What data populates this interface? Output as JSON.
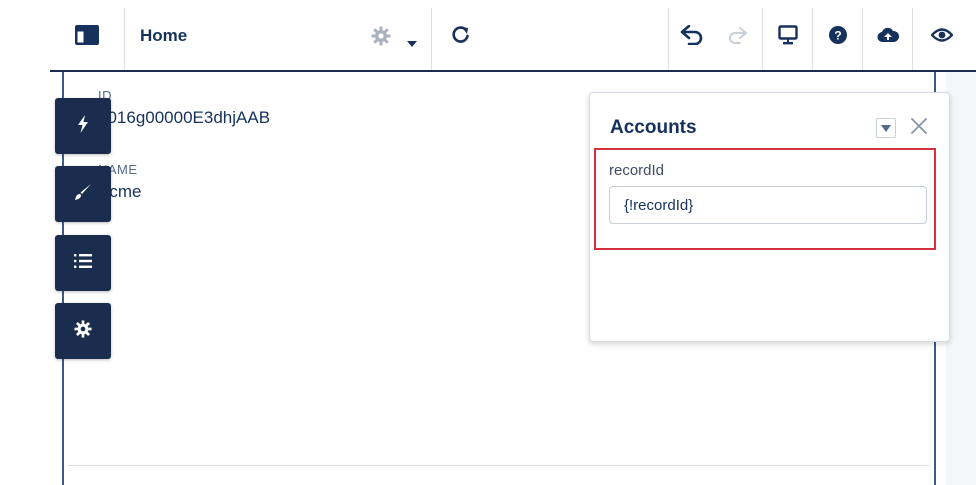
{
  "toolbar": {
    "tab_label": "Home",
    "icons": [
      "panel-layout-icon",
      "gear-icon",
      "chevron-down-icon",
      "refresh-icon",
      "undo-icon",
      "redo-icon",
      "preview-monitor-icon",
      "help-icon",
      "cloud-upload-icon",
      "eye-icon"
    ]
  },
  "record": {
    "fields": [
      {
        "label": "ID",
        "value": "0016g00000E3dhjAAB"
      },
      {
        "label": "NAME",
        "value": "Acme"
      }
    ]
  },
  "side_buttons": [
    "lightning-icon",
    "brush-icon",
    "list-icon",
    "gear-icon"
  ],
  "properties_panel": {
    "title": "Accounts",
    "property_label": "recordId",
    "property_value": "{!recordId}"
  },
  "colors": {
    "navy": "#1b2d4f",
    "highlight": "#d6303c",
    "canvas_border": "#3b5b85"
  }
}
